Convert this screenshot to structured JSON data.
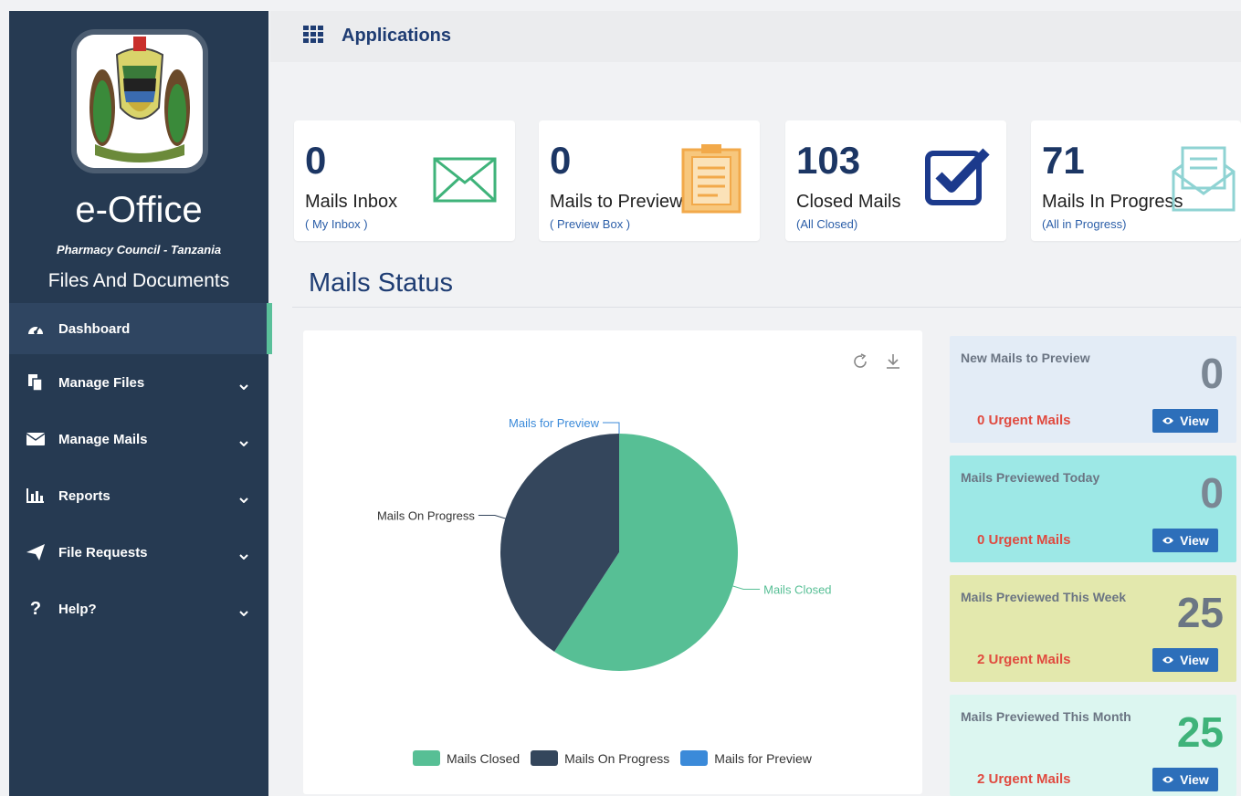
{
  "sidebar": {
    "brand": "e-Office",
    "organization": "Pharmacy Council - Tanzania",
    "section": "Files And Documents",
    "items": [
      {
        "label": "Dashboard",
        "icon": "dashboard-icon",
        "active": true
      },
      {
        "label": "Manage Files",
        "icon": "files-icon"
      },
      {
        "label": "Manage Mails",
        "icon": "mail-icon"
      },
      {
        "label": "Reports",
        "icon": "chart-icon"
      },
      {
        "label": "File Requests",
        "icon": "send-icon"
      },
      {
        "label": "Help?",
        "icon": "question-icon"
      }
    ]
  },
  "topbar": {
    "label": "Applications"
  },
  "cards": [
    {
      "value": "0",
      "title": "Mails Inbox",
      "link": "( My Inbox )",
      "icon": "envelope-icon",
      "color": "#3fb37a"
    },
    {
      "value": "0",
      "title": "Mails to Preview",
      "link": "( Preview Box )",
      "icon": "clipboard-icon",
      "color": "#f2a94a"
    },
    {
      "value": "103",
      "title": "Closed Mails",
      "link": "(All Closed)",
      "icon": "check-box-icon",
      "color": "#1c3a8c"
    },
    {
      "value": "71",
      "title": "Mails In Progress",
      "link": "(All in Progress)",
      "icon": "open-envelope-icon",
      "color": "#8fd3d3"
    }
  ],
  "status_title": "Mails Status",
  "chart_data": {
    "type": "pie",
    "title": "",
    "series": [
      {
        "name": "Mails Closed",
        "value": 103,
        "color": "#57bf95"
      },
      {
        "name": "Mails On Progress",
        "value": 71,
        "color": "#34465c"
      },
      {
        "name": "Mails for Preview",
        "value": 0,
        "color": "#3b8ad9"
      }
    ],
    "legend": "bottom"
  },
  "panels": [
    {
      "title": "New Mails to Preview",
      "count": "0",
      "urgent": "0 Urgent Mails",
      "view": "View",
      "bg": "#e3ecf6",
      "count_color": "#7b8794"
    },
    {
      "title": "Mails Previewed Today",
      "count": "0",
      "urgent": "0 Urgent Mails",
      "view": "View",
      "bg": "#9de8e6",
      "count_color": "#7b8794"
    },
    {
      "title": "Mails Previewed This Week",
      "count": "25",
      "urgent": "2 Urgent Mails",
      "view": "View",
      "bg": "#e3e8ad",
      "count_color": "#6b7684"
    },
    {
      "title": "Mails Previewed This Month",
      "count": "25",
      "urgent": "2 Urgent Mails",
      "view": "View",
      "bg": "#dcf6f0",
      "count_color": "#3fb37a"
    }
  ]
}
